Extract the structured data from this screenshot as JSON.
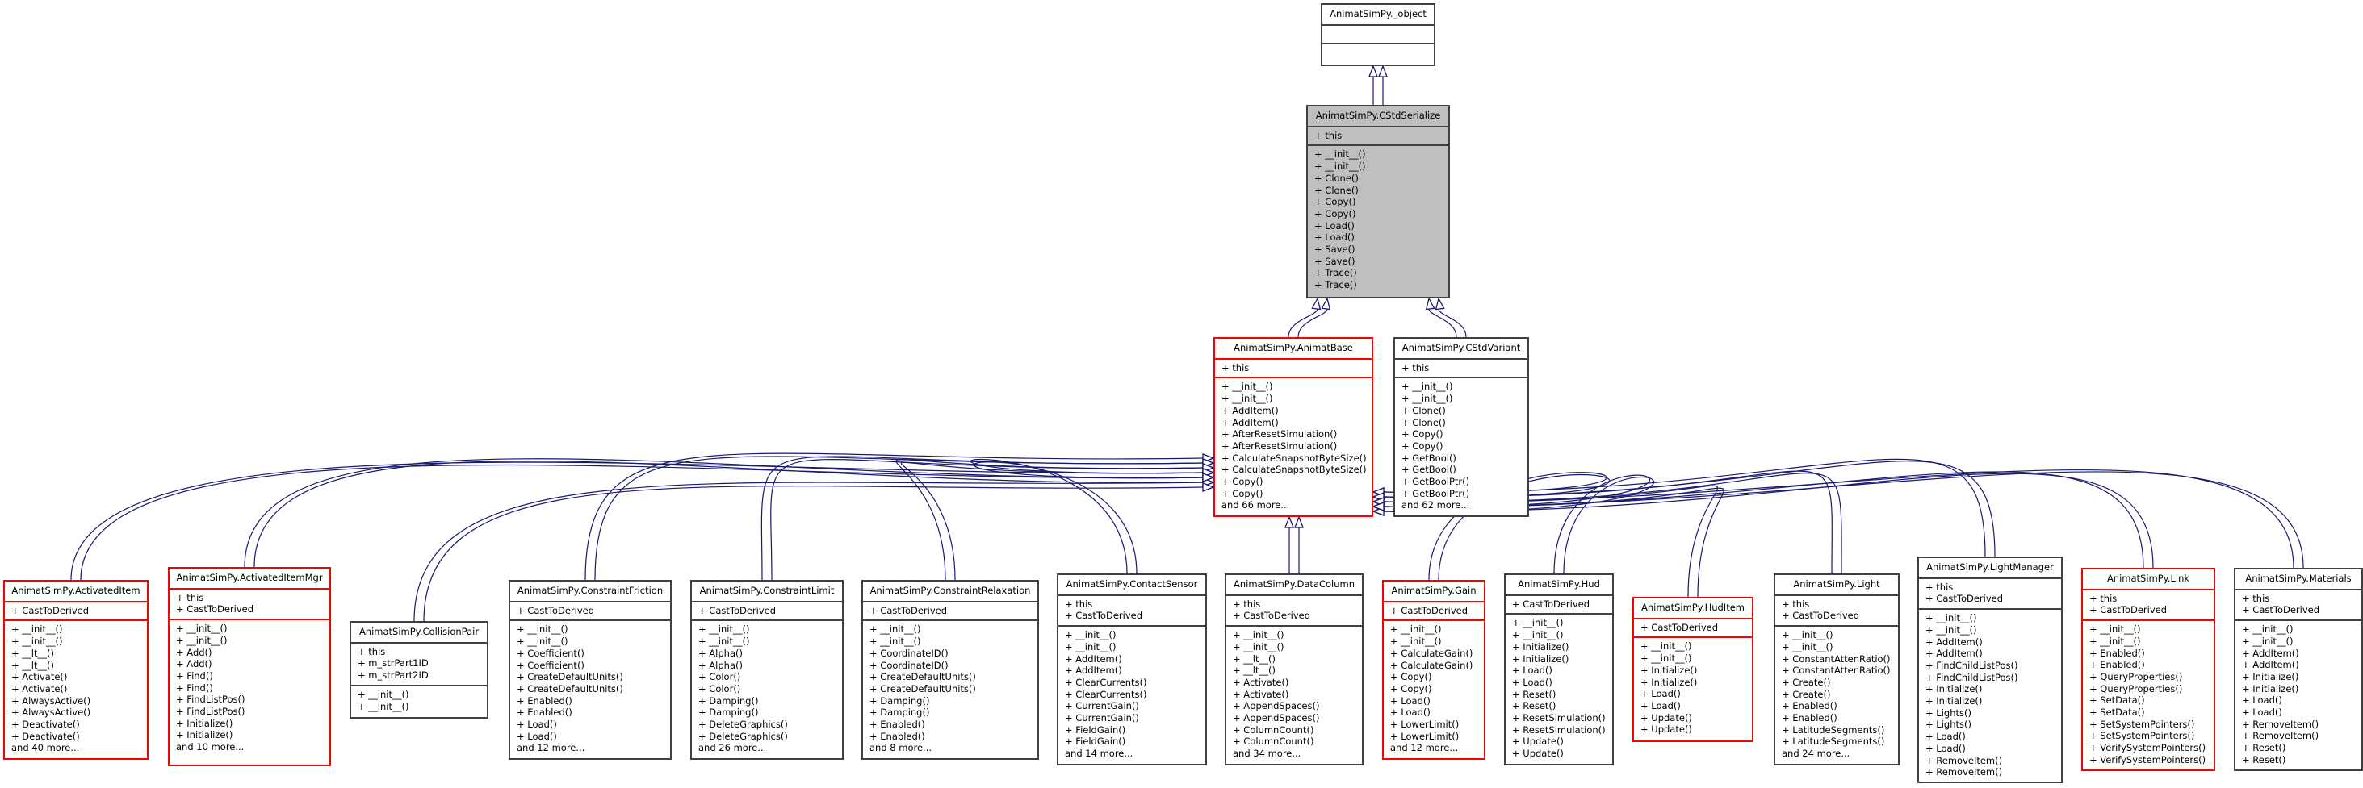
{
  "diagram": {
    "type": "class-inheritance",
    "colors": {
      "edge": "#191970",
      "border_default": "#404040",
      "border_highlight": "#ff0000",
      "focus_fill": "#bfbfbf"
    },
    "classes": [
      {
        "id": "object",
        "name": "AnimatSimPy._object",
        "attrs": [],
        "methods": []
      },
      {
        "id": "cstdserialize",
        "name": "AnimatSimPy.CStdSerialize",
        "focus": true,
        "attrs": [
          "+ this"
        ],
        "methods": [
          "+ __init__()",
          "+ __init__()",
          "+ Clone()",
          "+ Clone()",
          "+ Copy()",
          "+ Copy()",
          "+ Load()",
          "+ Load()",
          "+ Save()",
          "+ Save()",
          "+ Trace()",
          "+ Trace()"
        ]
      },
      {
        "id": "animatbase",
        "name": "AnimatSimPy.AnimatBase",
        "highlight": true,
        "attrs": [
          "+ this"
        ],
        "methods": [
          "+ __init__()",
          "+ __init__()",
          "+ AddItem()",
          "+ AddItem()",
          "+ AfterResetSimulation()",
          "+ AfterResetSimulation()",
          "+ CalculateSnapshotByteSize()",
          "+ CalculateSnapshotByteSize()",
          "+ Copy()",
          "+ Copy()",
          "and 66 more..."
        ]
      },
      {
        "id": "cstdvariant",
        "name": "AnimatSimPy.CStdVariant",
        "attrs": [
          "+ this"
        ],
        "methods": [
          "+ __init__()",
          "+ __init__()",
          "+ Clone()",
          "+ Clone()",
          "+ Copy()",
          "+ Copy()",
          "+ GetBool()",
          "+ GetBool()",
          "+ GetBoolPtr()",
          "+ GetBoolPtr()",
          "and 62 more..."
        ]
      },
      {
        "id": "activateditem",
        "name": "AnimatSimPy.ActivatedItem",
        "highlight": true,
        "attrs": [
          "+ CastToDerived"
        ],
        "methods": [
          "+ __init__()",
          "+ __init__()",
          "+ __lt__()",
          "+ __lt__()",
          "+ Activate()",
          "+ Activate()",
          "+ AlwaysActive()",
          "+ AlwaysActive()",
          "+ Deactivate()",
          "+ Deactivate()",
          "and 40 more..."
        ]
      },
      {
        "id": "activateditemmgr",
        "name": "AnimatSimPy.ActivatedItemMgr",
        "highlight": true,
        "attrs": [
          "+ this",
          "+ CastToDerived"
        ],
        "methods": [
          "+ __init__()",
          "+ __init__()",
          "+ Add()",
          "+ Add()",
          "+ Find()",
          "+ Find()",
          "+ FindListPos()",
          "+ FindListPos()",
          "+ Initialize()",
          "+ Initialize()",
          "and 10 more..."
        ]
      },
      {
        "id": "collisionpair",
        "name": "AnimatSimPy.CollisionPair",
        "attrs": [
          "+ this",
          "+ m_strPart1ID",
          "+ m_strPart2ID"
        ],
        "methods": [
          "+ __init__()",
          "+ __init__()"
        ]
      },
      {
        "id": "constraintfriction",
        "name": "AnimatSimPy.ConstraintFriction",
        "attrs": [
          "+ CastToDerived"
        ],
        "methods": [
          "+ __init__()",
          "+ __init__()",
          "+ Coefficient()",
          "+ Coefficient()",
          "+ CreateDefaultUnits()",
          "+ CreateDefaultUnits()",
          "+ Enabled()",
          "+ Enabled()",
          "+ Load()",
          "+ Load()",
          "and 12 more..."
        ]
      },
      {
        "id": "constraintlimit",
        "name": "AnimatSimPy.ConstraintLimit",
        "attrs": [
          "+ CastToDerived"
        ],
        "methods": [
          "+ __init__()",
          "+ __init__()",
          "+ Alpha()",
          "+ Alpha()",
          "+ Color()",
          "+ Color()",
          "+ Damping()",
          "+ Damping()",
          "+ DeleteGraphics()",
          "+ DeleteGraphics()",
          "and 26 more..."
        ]
      },
      {
        "id": "constraintrelaxation",
        "name": "AnimatSimPy.ConstraintRelaxation",
        "attrs": [
          "+ CastToDerived"
        ],
        "methods": [
          "+ __init__()",
          "+ __init__()",
          "+ CoordinateID()",
          "+ CoordinateID()",
          "+ CreateDefaultUnits()",
          "+ CreateDefaultUnits()",
          "+ Damping()",
          "+ Damping()",
          "+ Enabled()",
          "+ Enabled()",
          "and 8 more..."
        ]
      },
      {
        "id": "contactsensor",
        "name": "AnimatSimPy.ContactSensor",
        "attrs": [
          "+ this",
          "+ CastToDerived"
        ],
        "methods": [
          "+ __init__()",
          "+ __init__()",
          "+ AddItem()",
          "+ AddItem()",
          "+ ClearCurrents()",
          "+ ClearCurrents()",
          "+ CurrentGain()",
          "+ CurrentGain()",
          "+ FieldGain()",
          "+ FieldGain()",
          "and 14 more..."
        ]
      },
      {
        "id": "datacolumn",
        "name": "AnimatSimPy.DataColumn",
        "attrs": [
          "+ this",
          "+ CastToDerived"
        ],
        "methods": [
          "+ __init__()",
          "+ __init__()",
          "+ __lt__()",
          "+ __lt__()",
          "+ Activate()",
          "+ Activate()",
          "+ AppendSpaces()",
          "+ AppendSpaces()",
          "+ ColumnCount()",
          "+ ColumnCount()",
          "and 34 more..."
        ]
      },
      {
        "id": "gain",
        "name": "AnimatSimPy.Gain",
        "highlight": true,
        "attrs": [
          "+ CastToDerived"
        ],
        "methods": [
          "+ __init__()",
          "+ __init__()",
          "+ CalculateGain()",
          "+ CalculateGain()",
          "+ Copy()",
          "+ Copy()",
          "+ Load()",
          "+ Load()",
          "+ LowerLimit()",
          "+ LowerLimit()",
          "and 12 more..."
        ]
      },
      {
        "id": "hud",
        "name": "AnimatSimPy.Hud",
        "attrs": [
          "+ CastToDerived"
        ],
        "methods": [
          "+ __init__()",
          "+ __init__()",
          "+ Initialize()",
          "+ Initialize()",
          "+ Load()",
          "+ Load()",
          "+ Reset()",
          "+ Reset()",
          "+ ResetSimulation()",
          "+ ResetSimulation()",
          "+ Update()",
          "+ Update()"
        ]
      },
      {
        "id": "huditem",
        "name": "AnimatSimPy.HudItem",
        "highlight": true,
        "attrs": [
          "+ CastToDerived"
        ],
        "methods": [
          "+ __init__()",
          "+ __init__()",
          "+ Initialize()",
          "+ Initialize()",
          "+ Load()",
          "+ Load()",
          "+ Update()",
          "+ Update()"
        ]
      },
      {
        "id": "light",
        "name": "AnimatSimPy.Light",
        "attrs": [
          "+ this",
          "+ CastToDerived"
        ],
        "methods": [
          "+ __init__()",
          "+ __init__()",
          "+ ConstantAttenRatio()",
          "+ ConstantAttenRatio()",
          "+ Create()",
          "+ Create()",
          "+ Enabled()",
          "+ Enabled()",
          "+ LatitudeSegments()",
          "+ LatitudeSegments()",
          "and 24 more..."
        ]
      },
      {
        "id": "lightmanager",
        "name": "AnimatSimPy.LightManager",
        "attrs": [
          "+ this",
          "+ CastToDerived"
        ],
        "methods": [
          "+ __init__()",
          "+ __init__()",
          "+ AddItem()",
          "+ AddItem()",
          "+ FindChildListPos()",
          "+ FindChildListPos()",
          "+ Initialize()",
          "+ Initialize()",
          "+ Lights()",
          "+ Lights()",
          "+ Load()",
          "+ Load()",
          "+ RemoveItem()",
          "+ RemoveItem()"
        ]
      },
      {
        "id": "link",
        "name": "AnimatSimPy.Link",
        "highlight": true,
        "attrs": [
          "+ this",
          "+ CastToDerived"
        ],
        "methods": [
          "+ __init__()",
          "+ __init__()",
          "+ Enabled()",
          "+ Enabled()",
          "+ QueryProperties()",
          "+ QueryProperties()",
          "+ SetData()",
          "+ SetData()",
          "+ SetSystemPointers()",
          "+ SetSystemPointers()",
          "+ VerifySystemPointers()",
          "+ VerifySystemPointers()"
        ]
      },
      {
        "id": "materials",
        "name": "AnimatSimPy.Materials",
        "attrs": [
          "+ this",
          "+ CastToDerived"
        ],
        "methods": [
          "+ __init__()",
          "+ __init__()",
          "+ AddItem()",
          "+ AddItem()",
          "+ Initialize()",
          "+ Initialize()",
          "+ Load()",
          "+ Load()",
          "+ RemoveItem()",
          "+ RemoveItem()",
          "+ Reset()",
          "+ Reset()"
        ]
      }
    ],
    "inheritance": [
      {
        "child": "cstdserialize",
        "parent": "object"
      },
      {
        "child": "animatbase",
        "parent": "cstdserialize"
      },
      {
        "child": "cstdvariant",
        "parent": "cstdserialize"
      },
      {
        "child": "activateditem",
        "parent": "animatbase"
      },
      {
        "child": "activateditemmgr",
        "parent": "animatbase"
      },
      {
        "child": "collisionpair",
        "parent": "animatbase"
      },
      {
        "child": "constraintfriction",
        "parent": "animatbase"
      },
      {
        "child": "constraintlimit",
        "parent": "animatbase"
      },
      {
        "child": "constraintrelaxation",
        "parent": "animatbase"
      },
      {
        "child": "contactsensor",
        "parent": "animatbase"
      },
      {
        "child": "datacolumn",
        "parent": "animatbase"
      },
      {
        "child": "gain",
        "parent": "animatbase"
      },
      {
        "child": "hud",
        "parent": "animatbase"
      },
      {
        "child": "huditem",
        "parent": "animatbase"
      },
      {
        "child": "light",
        "parent": "animatbase"
      },
      {
        "child": "lightmanager",
        "parent": "animatbase"
      },
      {
        "child": "link",
        "parent": "animatbase"
      },
      {
        "child": "materials",
        "parent": "animatbase"
      }
    ]
  }
}
